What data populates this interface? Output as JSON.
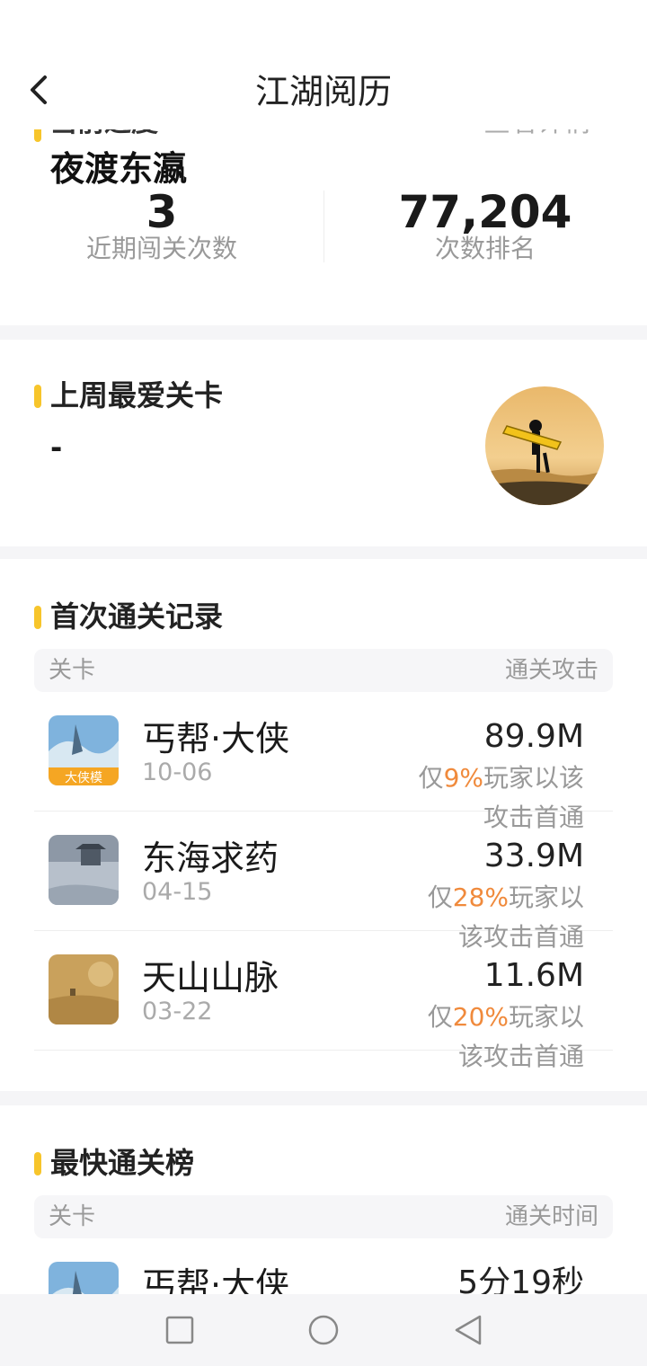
{
  "header": {
    "title": "江湖阅历"
  },
  "progress": {
    "clipped_label": "当前进度",
    "clipped_right": "查看详情",
    "level_name": "夜渡东瀛",
    "recent_count": "3",
    "recent_label": "近期闯关次数",
    "rank": "77,204",
    "rank_label": "次数排名"
  },
  "favorite": {
    "title": "上周最爱关卡",
    "value": "-"
  },
  "first_clear": {
    "title": "首次通关记录",
    "col_left": "关卡",
    "col_right": "通关攻击",
    "rows": [
      {
        "name": "丐帮·大侠",
        "date": "10-06",
        "value": "89.9M",
        "pre": "仅",
        "pct": "9%",
        "post1": "玩家以该",
        "post2": "攻击首通",
        "thumb_badge": "大侠模"
      },
      {
        "name": "东海求药",
        "date": "04-15",
        "value": "33.9M",
        "pre": "仅",
        "pct": "28%",
        "post1": "玩家以",
        "post2": "该攻击首通"
      },
      {
        "name": "天山山脉",
        "date": "03-22",
        "value": "11.6M",
        "pre": "仅",
        "pct": "20%",
        "post1": "玩家以",
        "post2": "该攻击首通"
      }
    ]
  },
  "fastest": {
    "title": "最快通关榜",
    "col_left": "关卡",
    "col_right": "通关时间",
    "rows": [
      {
        "name": "丐帮·大侠",
        "time": "5分19秒"
      }
    ]
  },
  "colors": {
    "accent": "#f7c52b",
    "highlight": "#f08a3c"
  },
  "icons": [
    "back-icon",
    "square-nav-icon",
    "circle-nav-icon",
    "triangle-nav-icon"
  ]
}
